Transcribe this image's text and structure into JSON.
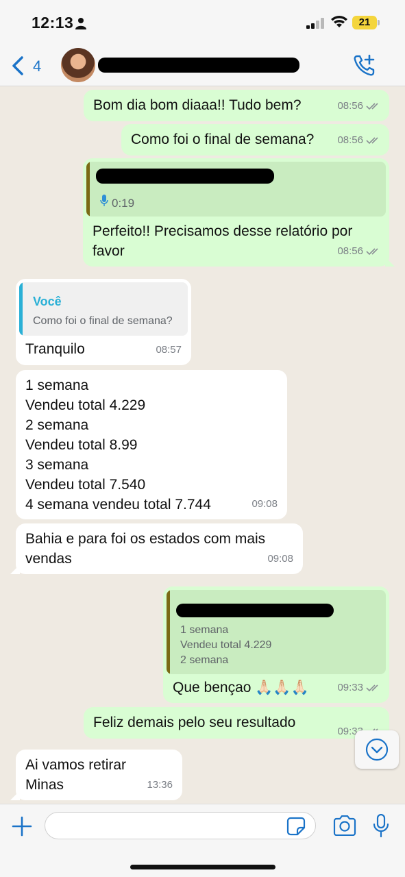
{
  "status_bar": {
    "time": "12:13",
    "battery": "21"
  },
  "header": {
    "back_count": "4",
    "contact_name": "",
    "accent_color": "#1a73c8"
  },
  "messages": [
    {
      "dir": "out",
      "text": "Bom dia bom diaaa!! Tudo bem?",
      "time": "08:56"
    },
    {
      "dir": "out",
      "text": "Como foi o final de semana?",
      "time": "08:56"
    },
    {
      "dir": "out",
      "quote": {
        "audio_duration": "0:19"
      },
      "text": "Perfeito!! Precisamos desse relatório por favor",
      "time": "08:56"
    },
    {
      "dir": "in",
      "quote": {
        "author": "Você",
        "text": "Como foi o final de semana?"
      },
      "text": "Tranquilo",
      "time": "08:57"
    },
    {
      "dir": "in",
      "lines": [
        "1 semana",
        "Vendeu total 4.229",
        "2 semana",
        "Vendeu total 8.99",
        "3 semana",
        "Vendeu total 7.540",
        "4 semana vendeu total 7.744"
      ],
      "time": "09:08"
    },
    {
      "dir": "in",
      "text": "Bahia e para foi os estados com mais vendas",
      "time": "09:08"
    },
    {
      "dir": "out",
      "quote": {
        "lines": [
          "1 semana",
          "Vendeu total 4.229",
          "2 semana"
        ]
      },
      "text": "Que bençao 🙏🏻🙏🏻🙏🏻",
      "time": "09:33"
    },
    {
      "dir": "out",
      "text": "Feliz demais pelo seu resultado",
      "time": "09:33"
    },
    {
      "dir": "in",
      "text": "Ai vamos retirar Minas",
      "time": "13:36"
    }
  ],
  "composer": {
    "placeholder": ""
  },
  "colors": {
    "outgoing_bubble": "#d9fdd3",
    "incoming_bubble": "#ffffff",
    "chat_background": "#efeae2",
    "quote_you": "#2ab0d6",
    "quote_other": "#7a6a14"
  }
}
